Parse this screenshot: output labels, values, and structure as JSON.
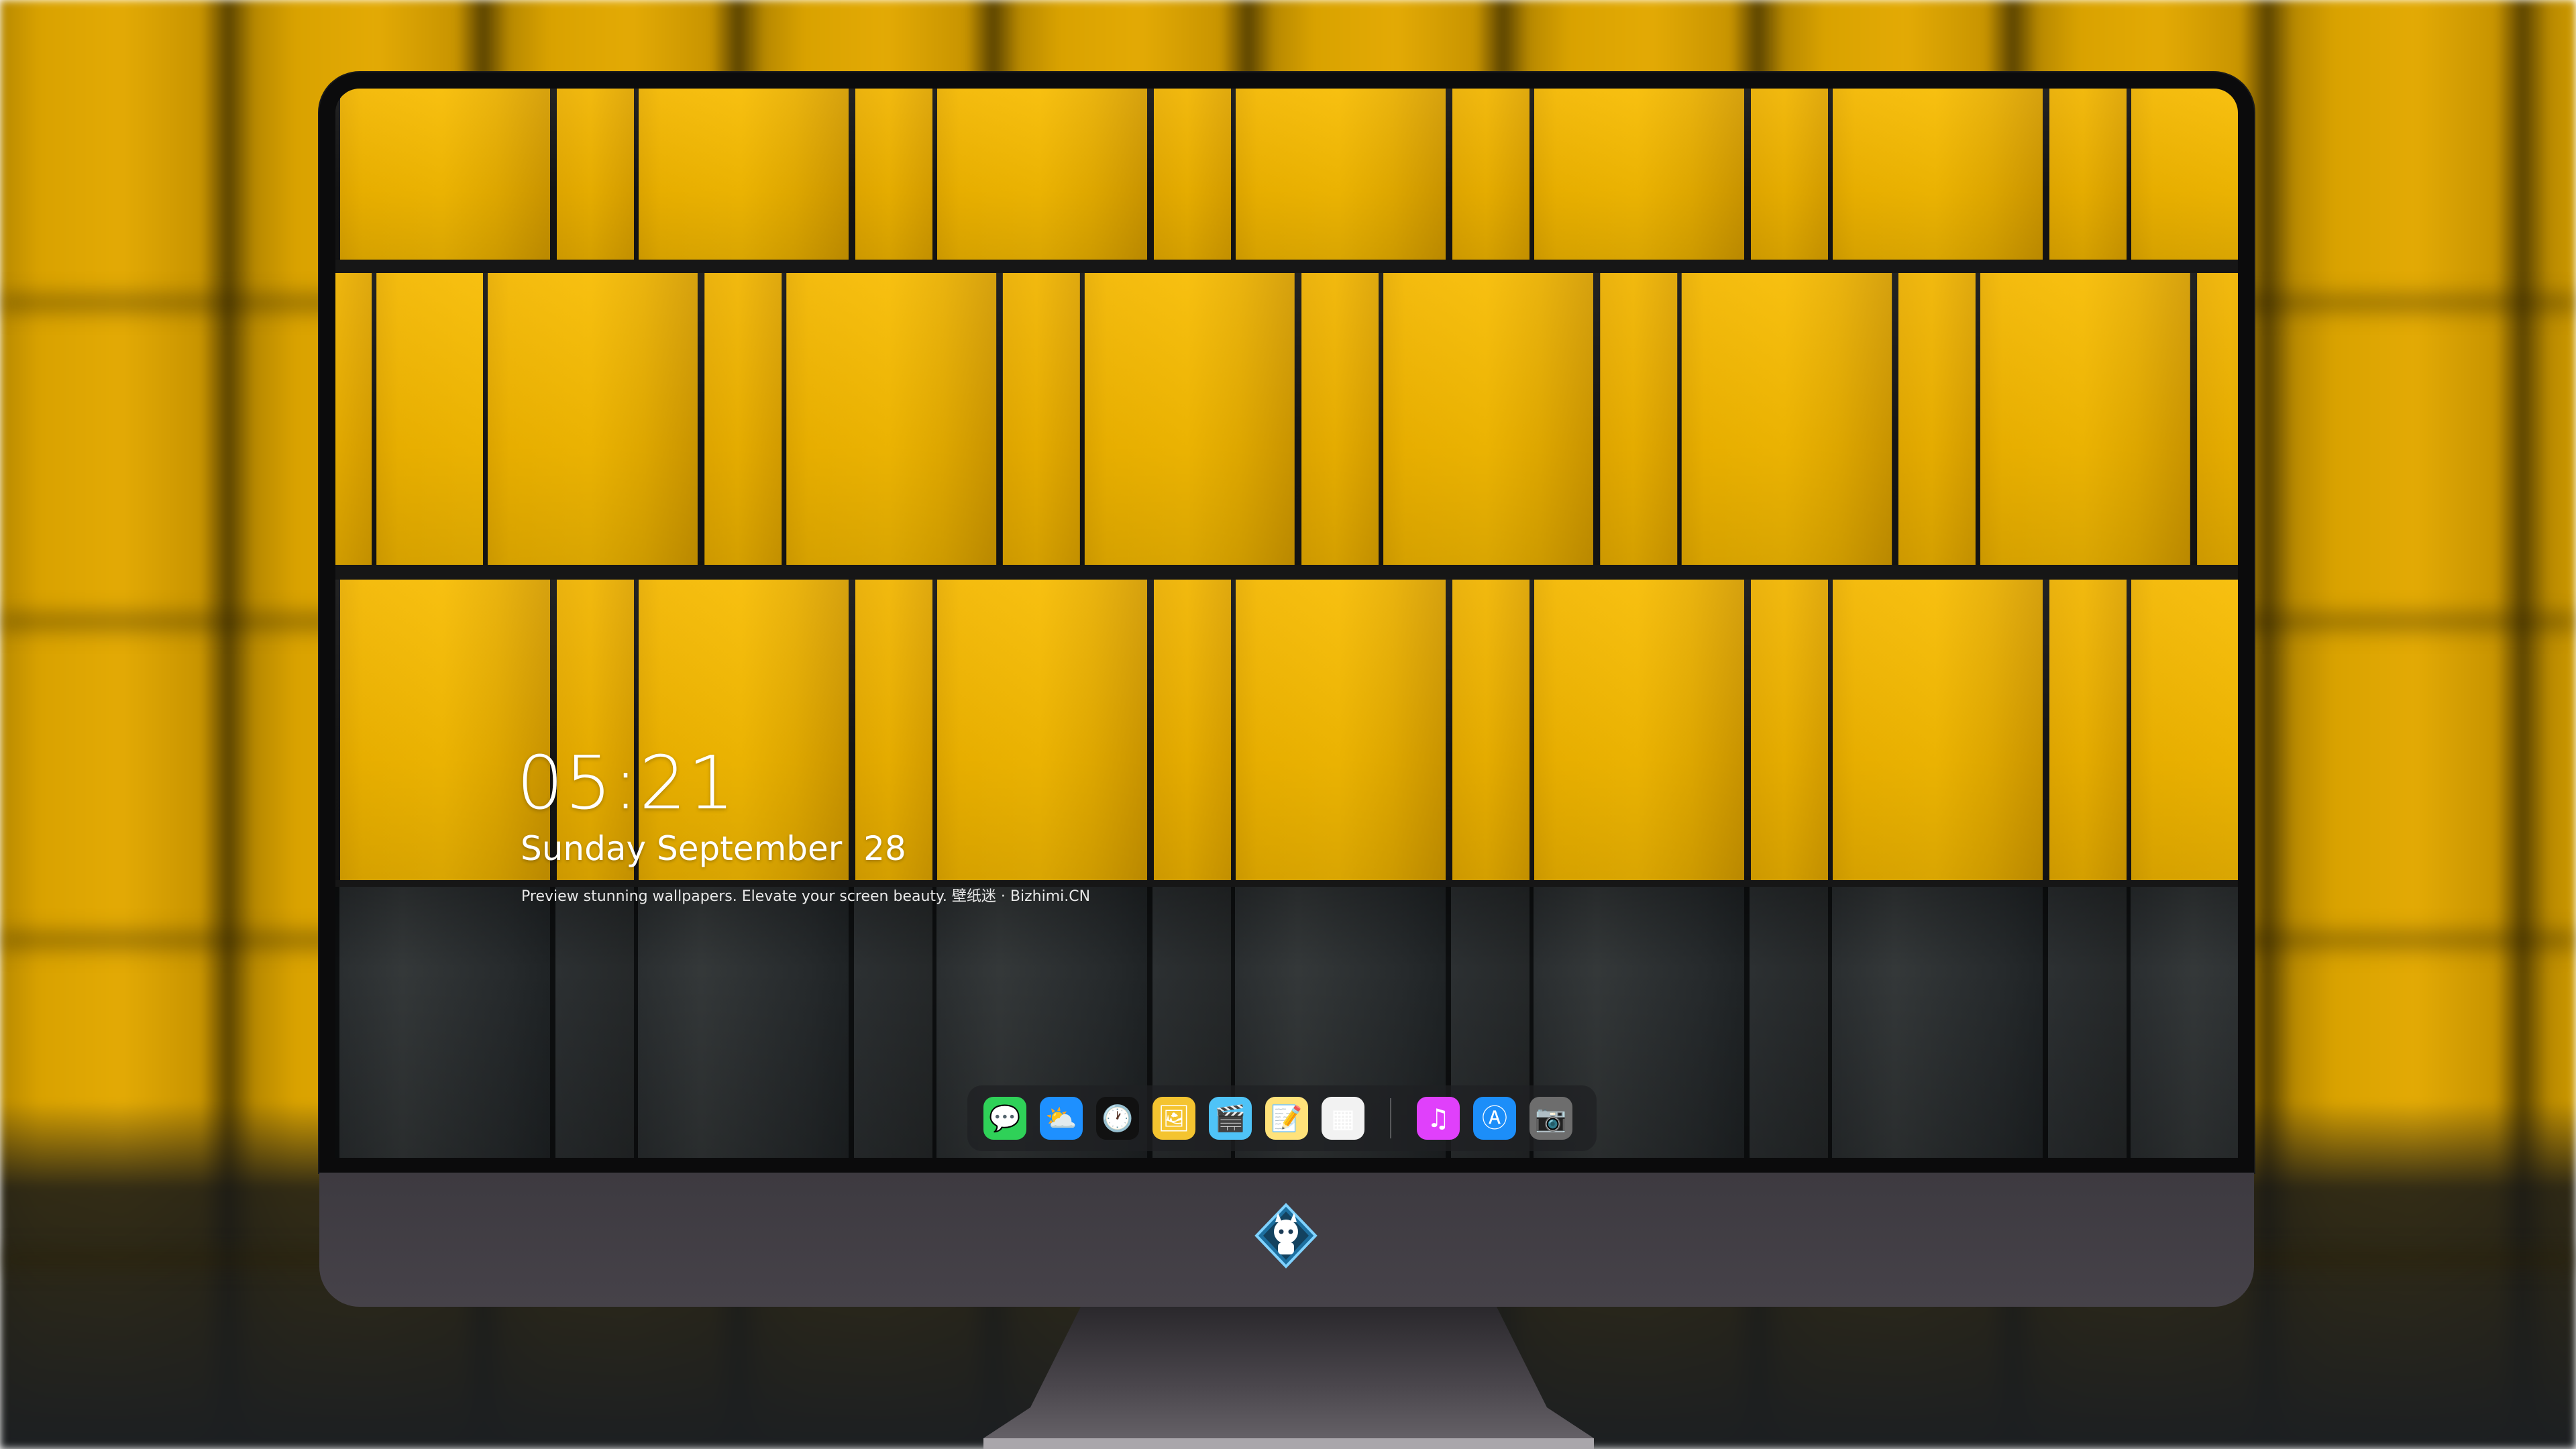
{
  "lock_screen": {
    "time": "05:21",
    "date": "Sunday September  28",
    "tagline": "Preview stunning wallpapers. Elevate your screen beauty. 壁纸迷 · Bizhimi.CN"
  },
  "dock": {
    "apps_left": [
      {
        "name": "messages",
        "icon": "chat-bubble-icon",
        "glyph": "💬",
        "color": "#2fd158"
      },
      {
        "name": "weather",
        "icon": "cloud-sun-icon",
        "glyph": "⛅",
        "color": "#1e90ff"
      },
      {
        "name": "clock",
        "icon": "clock-icon",
        "glyph": "🕐",
        "color": "#111111"
      },
      {
        "name": "preview",
        "icon": "preview-icon",
        "glyph": "🖼",
        "color": "#f4c430"
      },
      {
        "name": "clips",
        "icon": "clapperboard-icon",
        "glyph": "🎬",
        "color": "#4fc3f7"
      },
      {
        "name": "notes",
        "icon": "notes-icon",
        "glyph": "📝",
        "color": "#ffe27a"
      },
      {
        "name": "photo-booth",
        "icon": "photos-grid-icon",
        "glyph": "▦",
        "color": "#f2f2f2"
      }
    ],
    "apps_right": [
      {
        "name": "music",
        "icon": "music-note-icon",
        "glyph": "♫",
        "color": "#e040fb"
      },
      {
        "name": "app-store",
        "icon": "app-store-icon",
        "glyph": "Ⓐ",
        "color": "#1c8ef9"
      },
      {
        "name": "camera",
        "icon": "camera-icon",
        "glyph": "📷",
        "color": "#6d6d6d"
      }
    ]
  }
}
